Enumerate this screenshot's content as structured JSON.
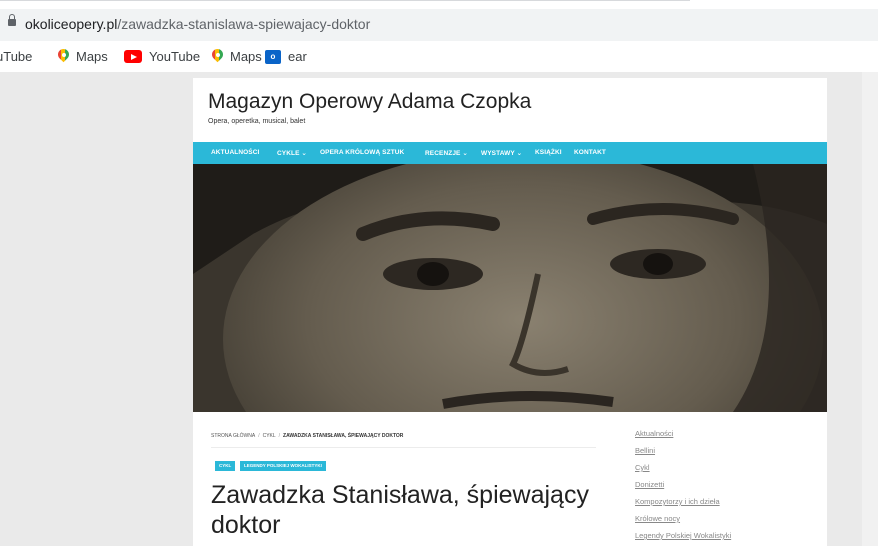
{
  "browser": {
    "url_domain": "okoliceopery.pl",
    "url_path": "/zawadzka-stanislawa-spiewajacy-doktor",
    "bookmarks": [
      {
        "label": "uTube",
        "icon": "youtube-icon-partial"
      },
      {
        "label": "Maps",
        "icon": "maps-pin-icon"
      },
      {
        "label": "YouTube",
        "icon": "youtube-icon"
      },
      {
        "label": "Maps",
        "icon": "maps-pin-icon"
      },
      {
        "label": "ear",
        "icon": "outlook-icon"
      }
    ],
    "outlook_icon_text": "o"
  },
  "site": {
    "title": "Magazyn Operowy Adama Czopka",
    "tagline": "Opera, operetka, musical, balet"
  },
  "nav": {
    "items": [
      {
        "label": "AKTUALNOŚCI"
      },
      {
        "label": "CYKLE ⌄"
      },
      {
        "label": "OPERA KRÓLOWĄ SZTUK"
      },
      {
        "label": "RECENZJE ⌄"
      },
      {
        "label": "WYSTAWY ⌄"
      },
      {
        "label": "KSIĄŻKI"
      },
      {
        "label": "KONTAKT"
      }
    ]
  },
  "hero": {
    "icon": "portrait-photo"
  },
  "breadcrumb": {
    "home": "STRONA GŁÓWNA",
    "sep": "/",
    "section": "CYKL",
    "current": "ZAWADZKA STANISŁAWA, ŚPIEWAJĄCY DOKTOR"
  },
  "tags": [
    "CYKL",
    "LEGENDY POLSKIEJ WOKALISTYKI"
  ],
  "post": {
    "title": "Zawadzka Stanisława, śpiewający doktor"
  },
  "sidebar": {
    "links": [
      "Aktualności",
      "Bellini",
      "Cykl",
      "Donizetti",
      "Kompozytorzy i ich dzieła",
      "Królowe nocy",
      "Legendy Polskiej Wokalistyki"
    ]
  },
  "colors": {
    "accent": "#2bb8d8",
    "page_bg": "#eaeaea"
  }
}
